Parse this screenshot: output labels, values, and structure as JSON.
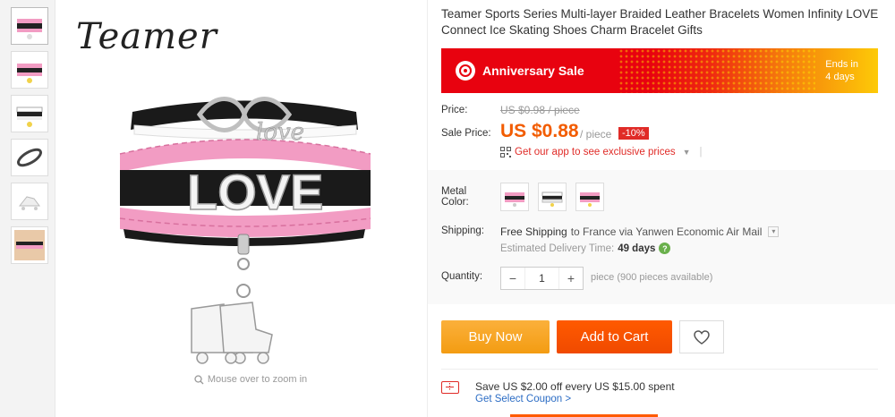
{
  "product": {
    "brand_logo": "Teamer",
    "title": "Teamer Sports Series Multi-layer Braided Leather Bracelets Women Infinity LOVE Connect Ice Skating Shoes Charm Bracelet Gifts",
    "zoom_hint": "Mouse over to zoom in",
    "charm_text": "LOVE",
    "infinity_text": "love"
  },
  "banner": {
    "label": "Anniversary Sale",
    "ends_line1": "Ends in",
    "ends_line2": "4 days"
  },
  "price": {
    "label": "Price:",
    "original": "US $0.98 / piece",
    "sale_label": "Sale Price:",
    "sale_value": "US $0.88",
    "per_piece": "/ piece",
    "discount": "-10%",
    "app_link": "Get our app to see exclusive prices"
  },
  "options": {
    "color_label_line1": "Metal",
    "color_label_line2": "Color:",
    "shipping_label": "Shipping:",
    "shipping_free": "Free Shipping",
    "shipping_rest": "to France via Yanwen Economic Air Mail",
    "delivery_label": "Estimated Delivery Time:",
    "delivery_value": "49 days",
    "quantity_label": "Quantity:",
    "quantity_value": "1",
    "quantity_note": "piece (900 pieces available)"
  },
  "actions": {
    "buy_now": "Buy Now",
    "add_to_cart": "Add to Cart"
  },
  "coupon": {
    "text": "Save US $2.00 off every US $15.00 spent",
    "link": "Get Select Coupon >"
  },
  "colors": {
    "accent_orange": "#ff5a00",
    "price_orange": "#f25c00",
    "sale_red": "#e8020f",
    "link_blue": "#2b6cc4",
    "strap_pink": "#f29cc3"
  }
}
